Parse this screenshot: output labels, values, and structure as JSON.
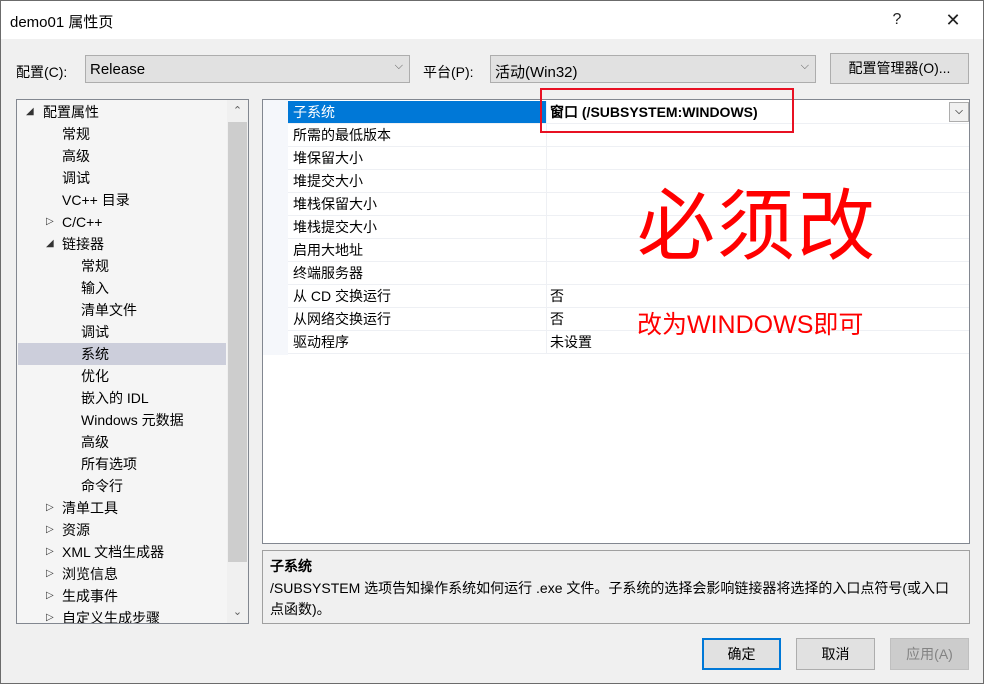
{
  "window": {
    "title": "demo01 属性页",
    "help_label": "?",
    "close_label": "✕"
  },
  "toolbar": {
    "config_label": "配置(C):",
    "config_value": "Release",
    "platform_label": "平台(P):",
    "platform_value": "活动(Win32)",
    "config_manager_label": "配置管理器(O)...",
    "chevron": "⌵"
  },
  "tree": {
    "items": [
      {
        "label": "配置属性",
        "level": 0,
        "arrow": "◢",
        "selected": false
      },
      {
        "label": "常规",
        "level": 1,
        "arrow": "",
        "selected": false
      },
      {
        "label": "高级",
        "level": 1,
        "arrow": "",
        "selected": false
      },
      {
        "label": "调试",
        "level": 1,
        "arrow": "",
        "selected": false
      },
      {
        "label": "VC++ 目录",
        "level": 1,
        "arrow": "",
        "selected": false
      },
      {
        "label": "C/C++",
        "level": 1,
        "arrow": "▷",
        "selected": false
      },
      {
        "label": "链接器",
        "level": 1,
        "arrow": "◢",
        "selected": false
      },
      {
        "label": "常规",
        "level": 2,
        "arrow": "",
        "selected": false
      },
      {
        "label": "输入",
        "level": 2,
        "arrow": "",
        "selected": false
      },
      {
        "label": "清单文件",
        "level": 2,
        "arrow": "",
        "selected": false
      },
      {
        "label": "调试",
        "level": 2,
        "arrow": "",
        "selected": false
      },
      {
        "label": "系统",
        "level": 2,
        "arrow": "",
        "selected": true
      },
      {
        "label": "优化",
        "level": 2,
        "arrow": "",
        "selected": false
      },
      {
        "label": "嵌入的 IDL",
        "level": 2,
        "arrow": "",
        "selected": false
      },
      {
        "label": "Windows 元数据",
        "level": 2,
        "arrow": "",
        "selected": false
      },
      {
        "label": "高级",
        "level": 2,
        "arrow": "",
        "selected": false
      },
      {
        "label": "所有选项",
        "level": 2,
        "arrow": "",
        "selected": false
      },
      {
        "label": "命令行",
        "level": 2,
        "arrow": "",
        "selected": false
      },
      {
        "label": "清单工具",
        "level": 1,
        "arrow": "▷",
        "selected": false
      },
      {
        "label": "资源",
        "level": 1,
        "arrow": "▷",
        "selected": false
      },
      {
        "label": "XML 文档生成器",
        "level": 1,
        "arrow": "▷",
        "selected": false
      },
      {
        "label": "浏览信息",
        "level": 1,
        "arrow": "▷",
        "selected": false
      },
      {
        "label": "生成事件",
        "level": 1,
        "arrow": "▷",
        "selected": false
      },
      {
        "label": "自定义生成步骤",
        "level": 1,
        "arrow": "▷",
        "selected": false
      }
    ],
    "scroll_up": "⌃",
    "scroll_down": "⌄"
  },
  "properties": {
    "rows": [
      {
        "name": "子系统",
        "value": "窗口 (/SUBSYSTEM:WINDOWS)",
        "selected": true
      },
      {
        "name": "所需的最低版本",
        "value": "",
        "selected": false
      },
      {
        "name": "堆保留大小",
        "value": "",
        "selected": false
      },
      {
        "name": "堆提交大小",
        "value": "",
        "selected": false
      },
      {
        "name": "堆栈保留大小",
        "value": "",
        "selected": false
      },
      {
        "name": "堆栈提交大小",
        "value": "",
        "selected": false
      },
      {
        "name": "启用大地址",
        "value": "",
        "selected": false
      },
      {
        "name": "终端服务器",
        "value": "",
        "selected": false
      },
      {
        "name": "从 CD 交换运行",
        "value": "否",
        "selected": false
      },
      {
        "name": "从网络交换运行",
        "value": "否",
        "selected": false
      },
      {
        "name": "驱动程序",
        "value": "未设置",
        "selected": false
      }
    ]
  },
  "annotations": {
    "big": "必须改",
    "small": "改为WINDOWS即可",
    "color": "#ff0000"
  },
  "description": {
    "title": "子系统",
    "text": "/SUBSYSTEM 选项告知操作系统如何运行 .exe 文件。子系统的选择会影响链接器将选择的入口点符号(或入口点函数)。"
  },
  "buttons": {
    "ok": "确定",
    "cancel": "取消",
    "apply": "应用(A)"
  },
  "colors": {
    "accent": "#0078d7",
    "tree_selected": "#cccedb",
    "annotation": "#ff0000"
  }
}
